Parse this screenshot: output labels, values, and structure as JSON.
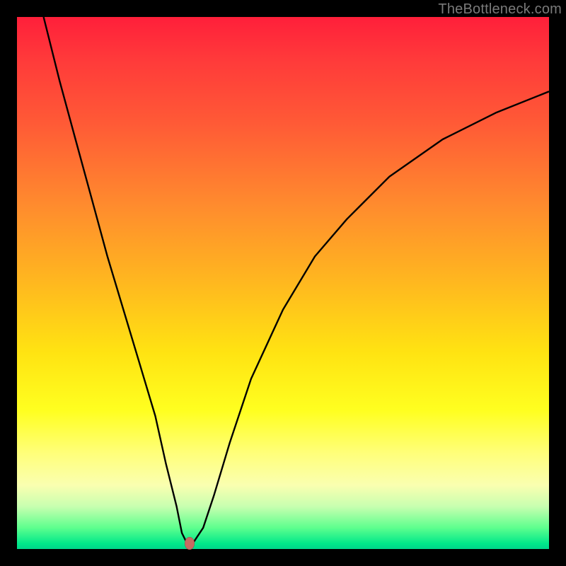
{
  "watermark": "TheBottleneck.com",
  "colors": {
    "curve": "#000000",
    "marker": "#c76a62",
    "frame": "#000000"
  },
  "chart_data": {
    "type": "line",
    "title": "",
    "xlabel": "",
    "ylabel": "",
    "xlim": [
      0,
      100
    ],
    "ylim": [
      0,
      100
    ],
    "grid": false,
    "series": [
      {
        "name": "bottleneck-curve",
        "x": [
          5,
          8,
          11,
          14,
          17,
          20,
          23,
          26,
          28,
          30,
          31,
          32,
          33,
          35,
          37,
          40,
          44,
          50,
          56,
          62,
          70,
          80,
          90,
          100
        ],
        "values": [
          100,
          88,
          77,
          66,
          55,
          45,
          35,
          25,
          16,
          8,
          3,
          1,
          1,
          4,
          10,
          20,
          32,
          45,
          55,
          62,
          70,
          77,
          82,
          86
        ]
      }
    ],
    "annotations": [
      {
        "name": "optimal-point",
        "x": 32.5,
        "y": 1
      }
    ]
  }
}
